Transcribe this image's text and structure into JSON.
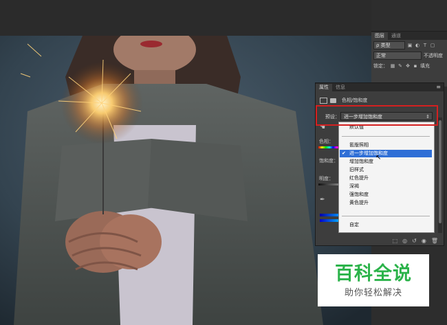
{
  "layers_panel": {
    "tabs": [
      "图层",
      "通道"
    ],
    "kind_filter": "ρ 类型",
    "blend_mode": "正常",
    "opacity_label": "不透明度",
    "lock_label": "锁定：",
    "fill_label": "填充"
  },
  "properties_panel": {
    "tabs": [
      "属性",
      "信息"
    ],
    "adjustment_title": "色相/饱和度",
    "preset_label": "预设：",
    "preset_value": "进一步增加饱和度",
    "hue_label": "色相：",
    "saturation_label": "饱和度：",
    "lightness_label": "明度："
  },
  "preset_dropdown": {
    "items": [
      "默认值",
      "氰版照相",
      "进一步增加饱和度",
      "增加饱和度",
      "旧样式",
      "红色提升",
      "深褐",
      "强饱和度",
      "黄色提升",
      "自定"
    ],
    "selected": "进一步增加饱和度"
  },
  "watermark": {
    "title": "百科全说",
    "subtitle": "助你轻松解决"
  },
  "icons": [
    "search-icon",
    "mask-icon",
    "hand-icon",
    "eyedropper-icon",
    "clip-layer-icon",
    "reset-icon",
    "visibility-icon",
    "trash-icon",
    "panel-menu-icon"
  ],
  "colors": {
    "panel_bg": "#3d3d3d",
    "highlight": "#2f6fd6",
    "annotation_red": "#d42020",
    "watermark_green": "#2bb34a"
  }
}
